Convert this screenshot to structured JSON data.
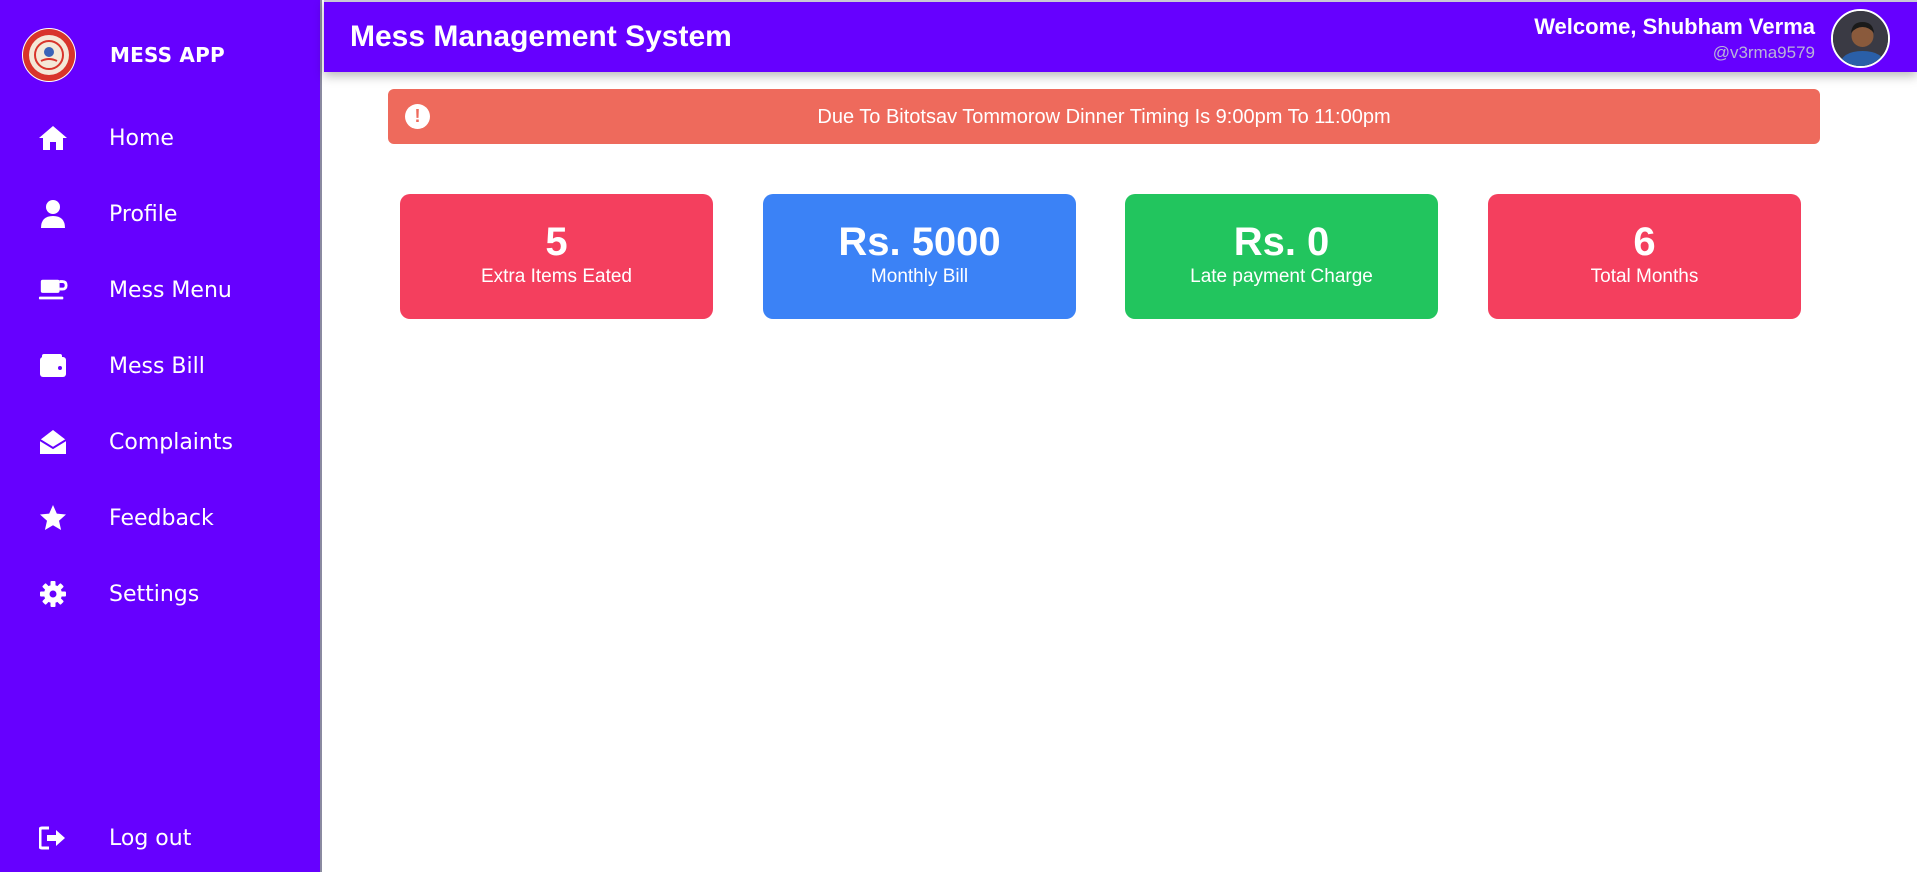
{
  "sidebar": {
    "brand": "MESS APP",
    "logo_icon": "institute-seal-icon",
    "items": [
      {
        "label": "Home",
        "icon": "home-icon"
      },
      {
        "label": "Profile",
        "icon": "user-icon"
      },
      {
        "label": "Mess Menu",
        "icon": "coffee-cup-icon"
      },
      {
        "label": "Mess Bill",
        "icon": "wallet-icon"
      },
      {
        "label": "Complaints",
        "icon": "envelope-open-icon"
      },
      {
        "label": "Feedback",
        "icon": "star-icon"
      },
      {
        "label": "Settings",
        "icon": "gear-icon"
      }
    ],
    "logout": {
      "label": "Log out",
      "icon": "sign-out-icon"
    }
  },
  "header": {
    "title": "Mess Management System",
    "welcome": "Welcome, Shubham Verma",
    "handle": "@v3rma9579"
  },
  "alert": {
    "icon": "exclamation-circle-icon",
    "text": "Due To Bitotsav Tommorow Dinner Timing Is 9:00pm To 11:00pm"
  },
  "cards": [
    {
      "value": "5",
      "label": "Extra Items Eated",
      "color": "#f43f5e"
    },
    {
      "value": "Rs. 5000",
      "label": "Monthly Bill",
      "color": "#3b82f6"
    },
    {
      "value": "Rs. 0",
      "label": "Late payment Charge",
      "color": "#22c55e"
    },
    {
      "value": "6",
      "label": "Total Months",
      "color": "#f43f5e"
    }
  ],
  "colors": {
    "primary": "#6600ff",
    "alert": "#ee6a5c"
  }
}
